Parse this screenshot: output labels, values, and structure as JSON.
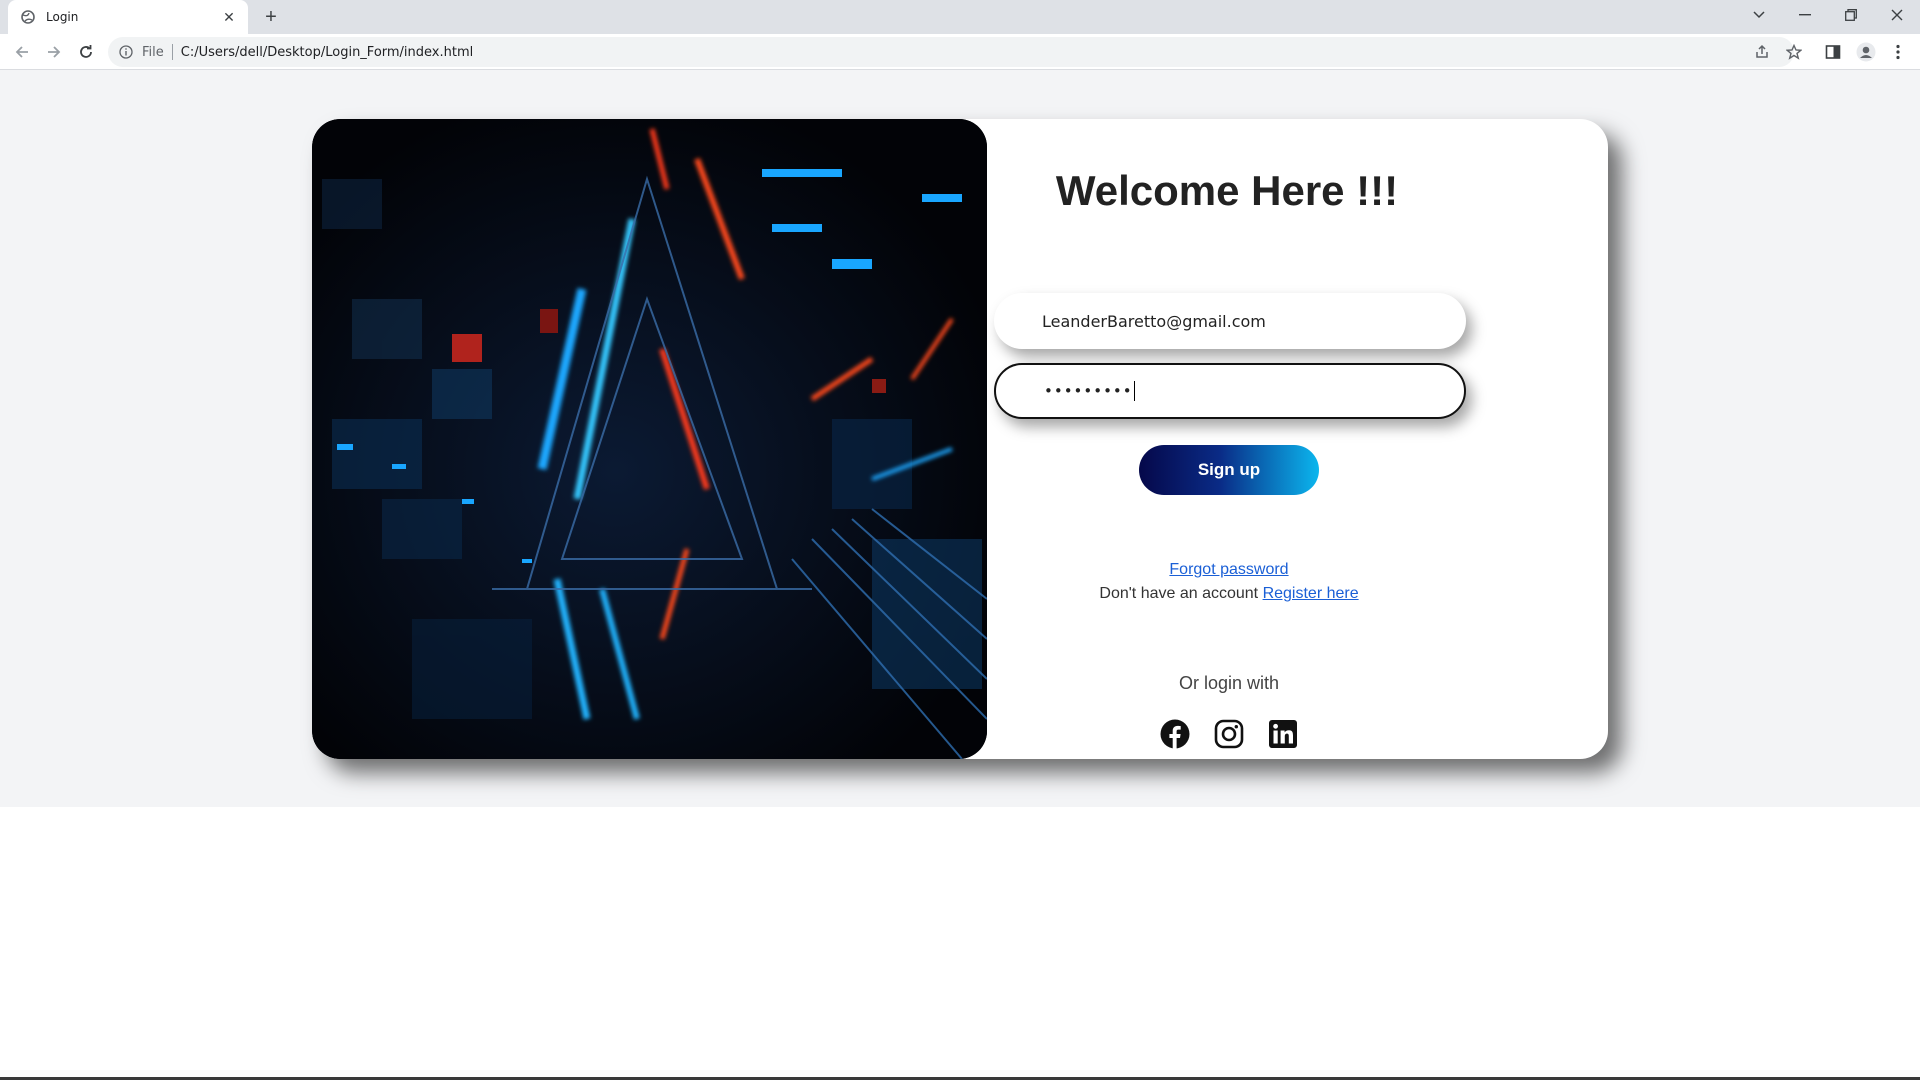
{
  "browser": {
    "tab_title": "Login",
    "omnibox_label": "File",
    "url": "C:/Users/dell/Desktop/Login_Form/index.html"
  },
  "login": {
    "heading": "Welcome Here !!!",
    "email_value": "LeanderBaretto@gmail.com",
    "password_value": "•••••••••",
    "signup_label": "Sign up",
    "forgot_label": "Forgot password",
    "no_account_text": "Don't have an account ",
    "register_label": "Register here",
    "or_login_text": "Or login with",
    "social_icons": [
      "facebook-icon",
      "instagram-icon",
      "linkedin-icon"
    ]
  },
  "colors": {
    "signup_gradient_start": "#05084a",
    "signup_gradient_end": "#0bb6ee",
    "link": "#1a5fd6",
    "page_bg": "#f3f4f6"
  }
}
